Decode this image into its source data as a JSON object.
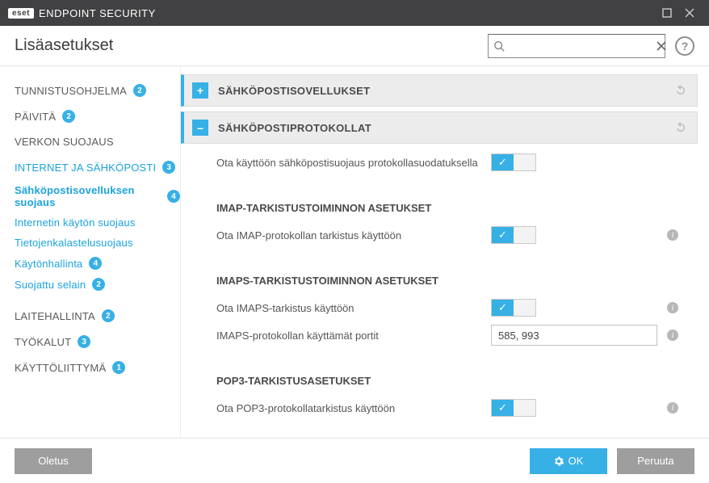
{
  "titlebar": {
    "logo": "eset",
    "product": "ENDPOINT SECURITY"
  },
  "header": {
    "title": "Lisäasetukset",
    "search_placeholder": ""
  },
  "sidebar": [
    {
      "label": "TUNNISTUSOHJELMA",
      "badge": "2",
      "type": "top"
    },
    {
      "label": "PÄIVITÄ",
      "badge": "2",
      "type": "top"
    },
    {
      "label": "VERKON SUOJAUS",
      "type": "top"
    },
    {
      "label": "INTERNET JA SÄHKÖPOSTI",
      "badge": "3",
      "type": "top",
      "link": true
    },
    {
      "label": "Sähköpostisovelluksen suojaus",
      "badge": "4",
      "type": "sub",
      "active": true
    },
    {
      "label": "Internetin käytön suojaus",
      "type": "sub",
      "link": true
    },
    {
      "label": "Tietojenkalastelusuojaus",
      "type": "sub",
      "link": true
    },
    {
      "label": "Käytönhallinta",
      "badge": "4",
      "type": "sub",
      "link": true
    },
    {
      "label": "Suojattu selain",
      "badge": "2",
      "type": "sub",
      "link": true
    },
    {
      "label": "LAITEHALLINTA",
      "badge": "2",
      "type": "top"
    },
    {
      "label": "TYÖKALUT",
      "badge": "3",
      "type": "top"
    },
    {
      "label": "KÄYTTÖLIITTYMÄ",
      "badge": "1",
      "type": "top"
    }
  ],
  "sections": {
    "apps": {
      "title": "SÄHKÖPOSTISOVELLUKSET"
    },
    "protocols": {
      "title": "SÄHKÖPOSTIPROTOKOLLAT",
      "enable_label": "Ota käyttöön sähköpostisuojaus protokollasuodatuksella"
    },
    "imap": {
      "heading": "IMAP-TARKISTUSTOIMINNON ASETUKSET",
      "enable_label": "Ota IMAP-protokollan tarkistus käyttöön"
    },
    "imaps": {
      "heading": "IMAPS-TARKISTUSTOIMINNON ASETUKSET",
      "enable_label": "Ota IMAPS-tarkistus käyttöön",
      "ports_label": "IMAPS-protokollan käyttämät portit",
      "ports_value": "585, 993"
    },
    "pop3": {
      "heading": "POP3-TARKISTUSASETUKSET",
      "enable_label": "Ota POP3-protokollatarkistus käyttöön"
    }
  },
  "footer": {
    "default": "Oletus",
    "ok": "OK",
    "cancel": "Peruuta"
  }
}
